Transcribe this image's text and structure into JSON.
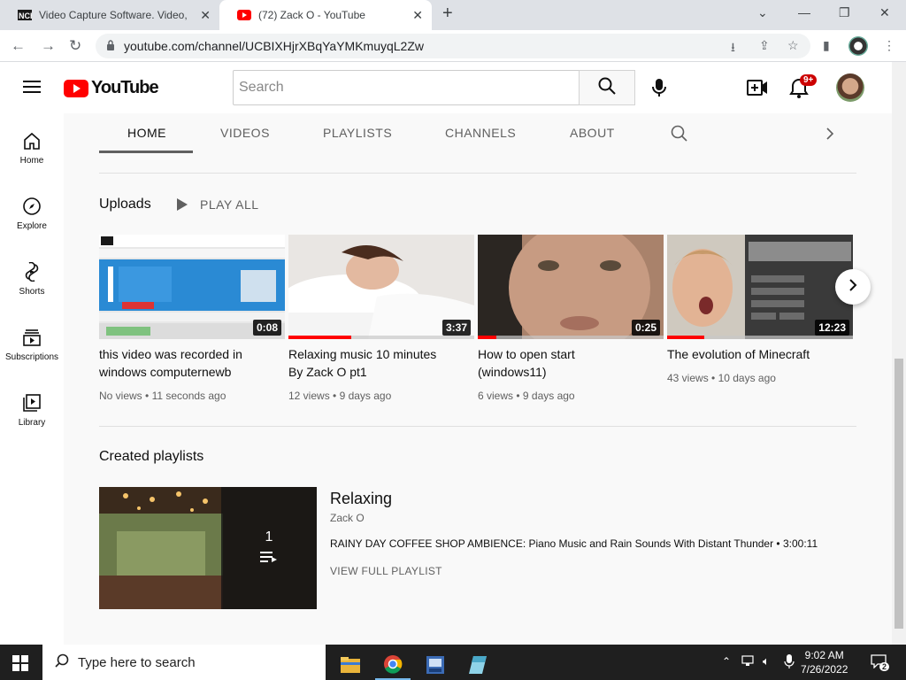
{
  "browser": {
    "tabs": [
      {
        "title": "Video Capture Software. Video, V",
        "favicon": "nch-icon",
        "active": false
      },
      {
        "title": "(72) Zack O - YouTube",
        "favicon": "youtube-icon",
        "active": true
      }
    ],
    "new_tab": "+",
    "url": "youtube.com/channel/UCBIXHjrXBqYaYMKmuyqL2Zw"
  },
  "header": {
    "logo_text": "YouTube",
    "search_placeholder": "Search",
    "notification_count": "9+"
  },
  "guide": {
    "items": [
      {
        "label": "Home",
        "icon": "home-icon"
      },
      {
        "label": "Explore",
        "icon": "compass-icon"
      },
      {
        "label": "Shorts",
        "icon": "shorts-icon"
      },
      {
        "label": "Subscriptions",
        "icon": "subscriptions-icon"
      },
      {
        "label": "Library",
        "icon": "library-icon"
      }
    ]
  },
  "channel_tabs": [
    "HOME",
    "VIDEOS",
    "PLAYLISTS",
    "CHANNELS",
    "ABOUT"
  ],
  "uploads": {
    "title": "Uploads",
    "play_all": "PLAY ALL",
    "videos": [
      {
        "title_line1": "this video was recorded in",
        "title_line2": "windows computernewb",
        "duration": "0:08",
        "views": "No views",
        "age": "11 seconds ago",
        "watched": 0
      },
      {
        "title_line1": "Relaxing music 10 minutes",
        "title_line2": "By Zack O pt1",
        "duration": "3:37",
        "views": "12 views",
        "age": "9 days ago",
        "watched": 0.34
      },
      {
        "title_line1": "How to open start",
        "title_line2": "(windows11)",
        "duration": "0:25",
        "views": "6 views",
        "age": "9 days ago",
        "watched": 0.1
      },
      {
        "title_line1": "The evolution of Minecraft",
        "title_line2": "",
        "duration": "12:23",
        "views": "43 views",
        "age": "10 days ago",
        "watched": 0.2
      }
    ]
  },
  "playlists": {
    "title": "Created playlists",
    "items": [
      {
        "name": "Relaxing",
        "owner": "Zack O",
        "count": "1",
        "first_video": "RAINY DAY COFFEE SHOP AMBIENCE: Piano Music and Rain Sounds With Distant Thunder",
        "first_duration": "3:00:11",
        "view_full": "VIEW FULL PLAYLIST"
      }
    ]
  },
  "taskbar": {
    "search_placeholder": "Type here to search",
    "time": "9:02 AM",
    "date": "7/26/2022",
    "notifications": "2"
  }
}
